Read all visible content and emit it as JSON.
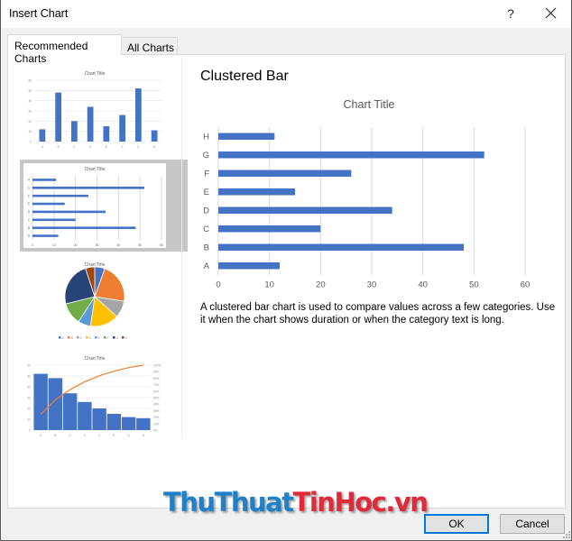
{
  "window": {
    "title": "Insert Chart",
    "help_label": "?",
    "close_icon": "close-icon"
  },
  "tabs": [
    {
      "label": "Recommended Charts",
      "active": true
    },
    {
      "label": "All Charts",
      "active": false
    }
  ],
  "thumbnails": [
    {
      "name": "Clustered Column",
      "selected": false
    },
    {
      "name": "Clustered Bar",
      "selected": true
    },
    {
      "name": "Pie",
      "selected": false
    },
    {
      "name": "Pareto",
      "selected": false
    }
  ],
  "preview": {
    "heading": "Clustered Bar",
    "description": "A clustered bar chart is used to compare values across a few categories. Use it when the chart shows duration or when the category text is long."
  },
  "buttons": {
    "ok": "OK",
    "cancel": "Cancel"
  },
  "watermark": {
    "part1": "ThuThuat",
    "part2": "TinHoc.vn"
  },
  "colors": {
    "bar": "#4472C4",
    "pareto_line": "#ED7D31",
    "pie": [
      "#4472C4",
      "#ED7D31",
      "#A5A5A5",
      "#FFC000",
      "#5B9BD5",
      "#70AD47",
      "#264478",
      "#9E480E"
    ],
    "ok_border": "#0078D7",
    "selection": "#C6C6C6"
  },
  "chart_data": [
    {
      "id": "preview",
      "type": "bar",
      "orientation": "horizontal",
      "title": "Chart Title",
      "categories": [
        "A",
        "B",
        "C",
        "D",
        "E",
        "F",
        "G",
        "H"
      ],
      "values": [
        12,
        48,
        20,
        34,
        15,
        26,
        52,
        11
      ],
      "xlim": [
        0,
        60
      ],
      "xticks": [
        "0",
        "10",
        "20",
        "30",
        "40",
        "50",
        "60"
      ],
      "grid": true
    },
    {
      "id": "thumb-column",
      "type": "bar",
      "orientation": "vertical",
      "title": "Chart Title",
      "categories": [
        "A",
        "B",
        "C",
        "D",
        "E",
        "F",
        "G",
        "H"
      ],
      "values": [
        12,
        48,
        20,
        34,
        15,
        26,
        52,
        11
      ],
      "ylim": [
        0,
        60
      ],
      "yticks": [
        "0",
        "10",
        "20",
        "30",
        "40",
        "50",
        "60"
      ]
    },
    {
      "id": "thumb-bar",
      "type": "bar",
      "orientation": "horizontal",
      "title": "Chart Title",
      "categories": [
        "A",
        "B",
        "C",
        "D",
        "E",
        "F",
        "G",
        "H"
      ],
      "values": [
        12,
        48,
        20,
        34,
        15,
        26,
        52,
        11
      ],
      "xlim": [
        0,
        60
      ],
      "xticks": [
        "0",
        "10",
        "20",
        "30",
        "40",
        "50",
        "60"
      ]
    },
    {
      "id": "thumb-pie",
      "type": "pie",
      "title": "Chart Title",
      "categories": [
        "A",
        "B",
        "C",
        "D",
        "E",
        "F",
        "G",
        "H"
      ],
      "values": [
        12,
        48,
        20,
        34,
        15,
        26,
        52,
        11
      ],
      "legend": "bottom"
    },
    {
      "id": "thumb-pareto",
      "type": "bar",
      "subtype": "pareto",
      "title": "Chart Title",
      "categories": [
        "G",
        "B",
        "D",
        "F",
        "C",
        "E",
        "A",
        "H"
      ],
      "values": [
        52,
        48,
        34,
        26,
        20,
        15,
        12,
        11
      ],
      "cumulative_percent": [
        24.2,
        46.5,
        62.3,
        74.4,
        83.7,
        90.7,
        96.3,
        100
      ],
      "ylim": [
        0,
        60
      ],
      "yticks": [
        "0",
        "10",
        "20",
        "30",
        "40",
        "50",
        "60"
      ],
      "y2lim": [
        0,
        100
      ],
      "y2ticks": [
        "0%",
        "10%",
        "20%",
        "30%",
        "40%",
        "50%",
        "60%",
        "70%",
        "80%",
        "90%",
        "100%"
      ]
    }
  ]
}
